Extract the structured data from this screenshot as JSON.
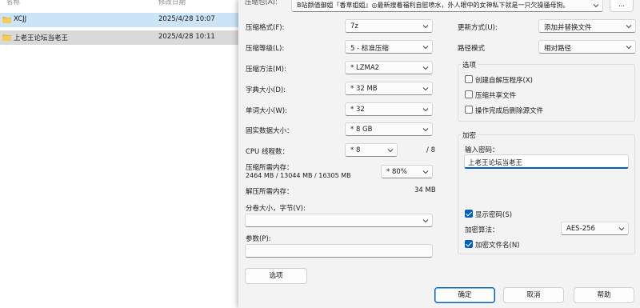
{
  "explorer": {
    "columns": {
      "name": "名称",
      "modified": "修改日期"
    },
    "rows": [
      {
        "name": "XCJJ",
        "date": "2025/4/28 10:07"
      },
      {
        "name": "上老王论坛当老王",
        "date": "2025/4/28 10:11"
      }
    ]
  },
  "dialog": {
    "archive_label": "压缩包(A):",
    "archive_name": "B站颜值御姐『香草姐姐』◎最新搜着福利自慰喷水，外人眼中的女神私下就是一只欠操骚母狗。",
    "browse_button": "...",
    "left": {
      "format_label": "压缩格式(F):",
      "format_value": "7z",
      "level_label": "压缩等级(L):",
      "level_value": "5 - 标准压缩",
      "method_label": "压缩方法(M):",
      "method_value": "* LZMA2",
      "dict_label": "字典大小(D):",
      "dict_value": "* 32 MB",
      "word_label": "单词大小(W):",
      "word_value": "* 32",
      "solid_label": "固实数据大小：",
      "solid_value": "* 8 GB",
      "threads_label": "CPU 线程数：",
      "threads_value": "* 8",
      "threads_max": "/ 8",
      "mem_label": "压缩所需内存：",
      "mem_detail": "2464 MB / 13044 MB / 16305 MB",
      "mem_value": "* 80%",
      "decomp_label": "解压所需内存：",
      "decomp_value": "34 MB",
      "split_label": "分卷大小，字节(V):",
      "split_value": "",
      "params_label": "参数(P):",
      "params_value": "",
      "options_button": "选项"
    },
    "right": {
      "update_label": "更新方式(U):",
      "update_value": "添加并替换文件",
      "path_label": "路径模式",
      "path_value": "相对路径",
      "options_group": "选项",
      "opt_sfx": "创建自解压程序(X)",
      "opt_shared": "压缩共享文件",
      "opt_delete": "操作完成后删除源文件",
      "encrypt_group": "加密",
      "pwd_label": "输入密码：",
      "pwd_value": "上老王论坛当老王",
      "show_pwd": "显示密码(S)",
      "enc_method_label": "加密算法：",
      "enc_method_value": "AES-256",
      "enc_names": "加密文件名(N)"
    },
    "ok_button": "确定",
    "cancel_button": "取消",
    "help_button": "帮助"
  }
}
